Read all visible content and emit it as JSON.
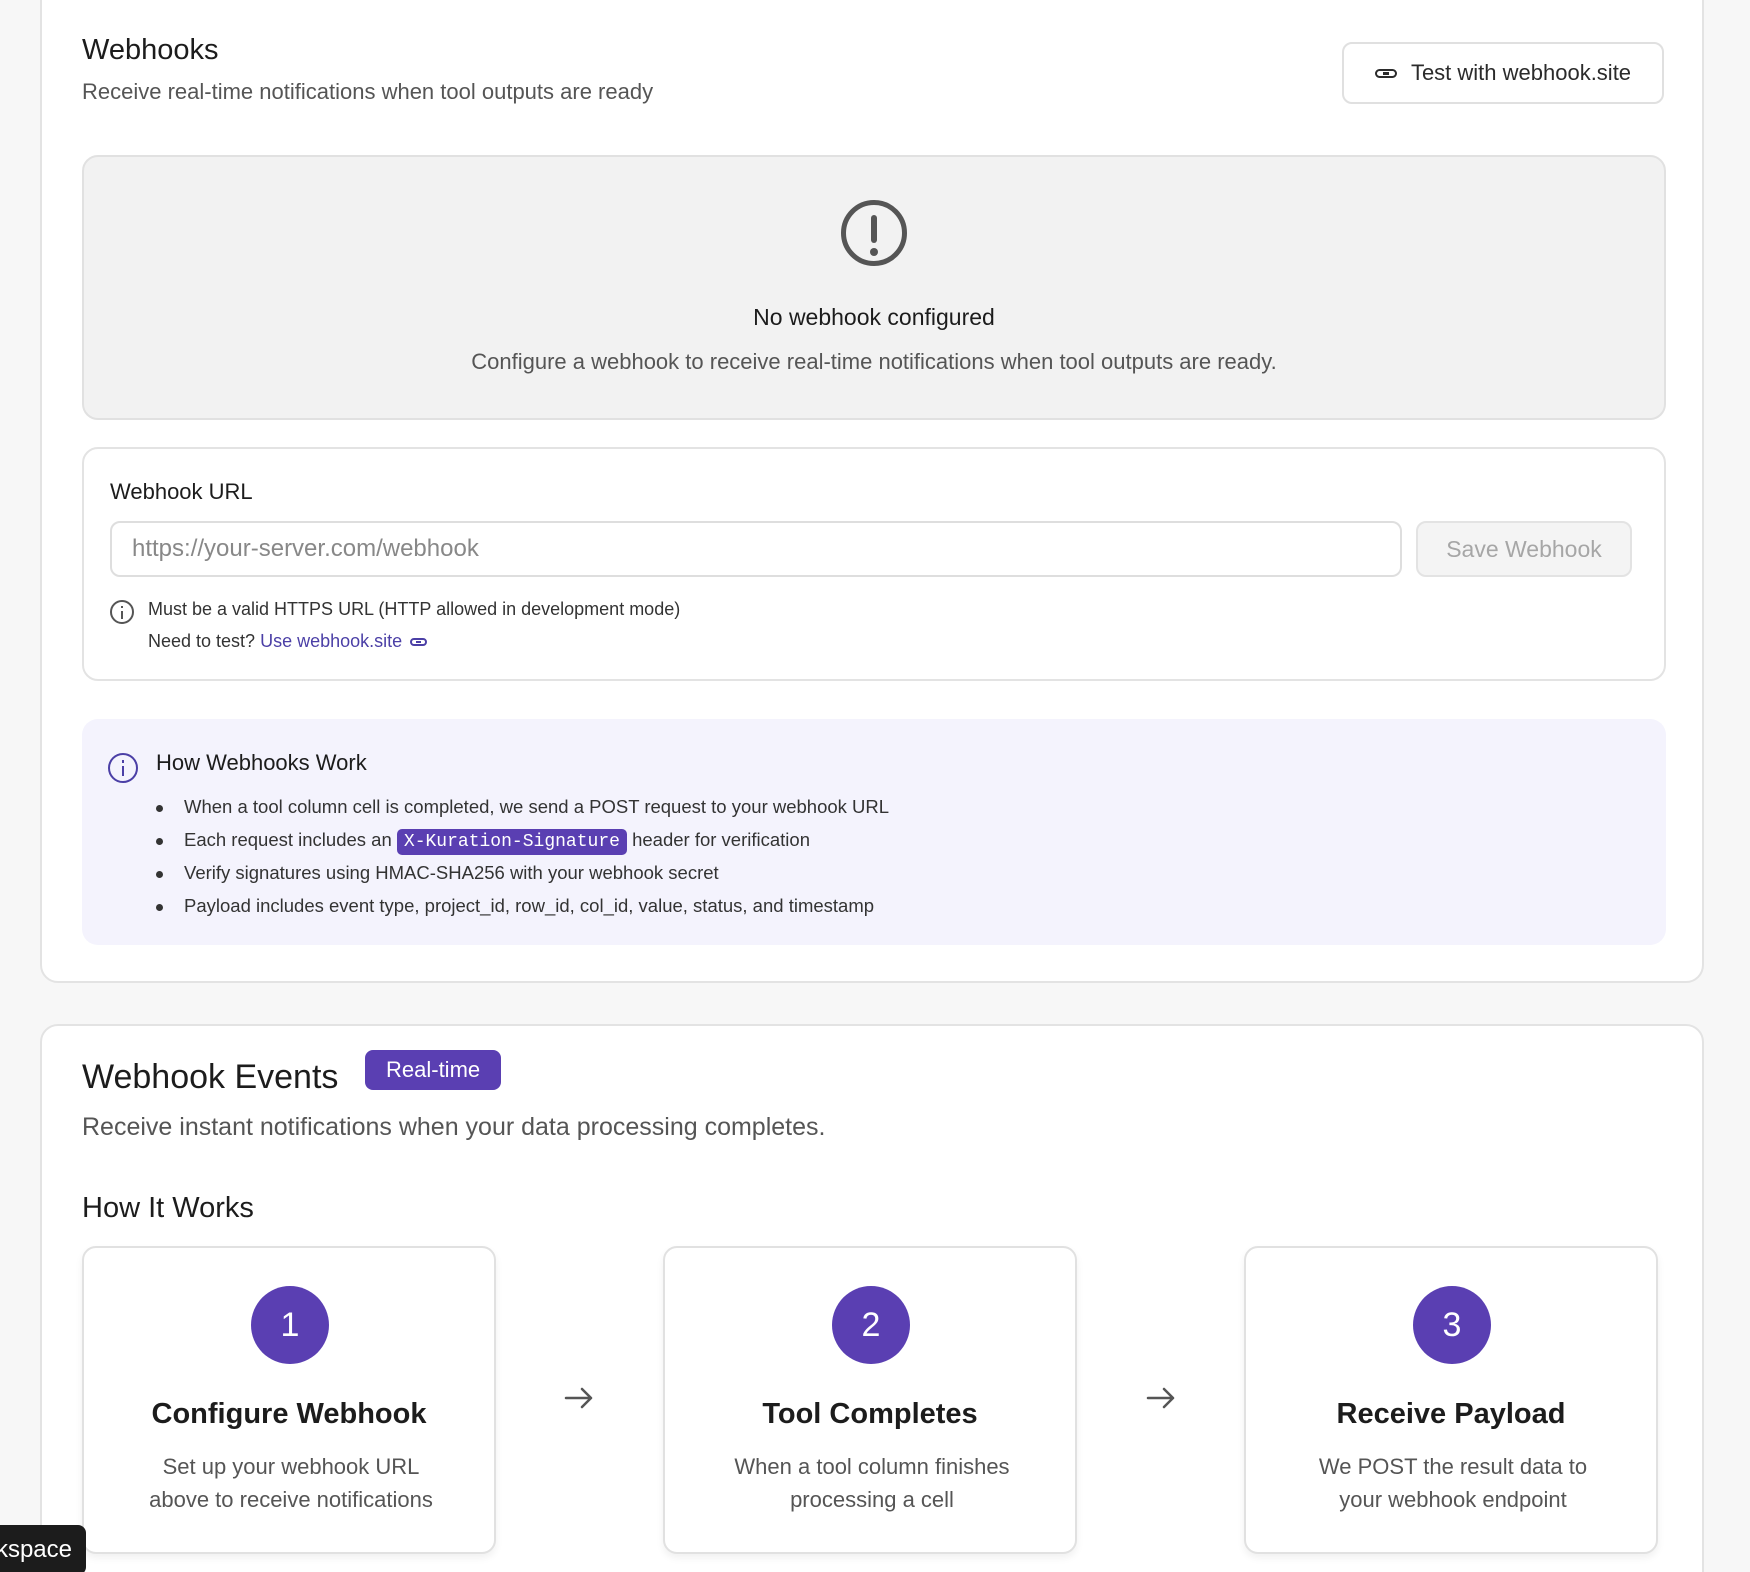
{
  "webhooks": {
    "title": "Webhooks",
    "subtitle": "Receive real-time notifications when tool outputs are ready",
    "test_button": "Test with webhook.site",
    "empty_state": {
      "icon": "alert-circle-icon",
      "title": "No webhook configured",
      "description": "Configure a webhook to receive real-time notifications when tool outputs are ready."
    },
    "url_form": {
      "label": "Webhook URL",
      "placeholder": "https://your-server.com/webhook",
      "value": "",
      "save_button": "Save Webhook",
      "help_text": "Must be a valid HTTPS URL (HTTP allowed in development mode)",
      "test_prefix": "Need to test?",
      "test_link": "Use webhook.site"
    },
    "how_it_works": {
      "title": "How Webhooks Work",
      "items": [
        "When a tool column cell is completed, we send a POST request to your webhook URL",
        "Verify signatures using HMAC-SHA256 with your webhook secret",
        "Payload includes event type, project_id, row_id, col_id, value, status, and timestamp"
      ],
      "signature_item": {
        "before": "Each request includes an",
        "code": "X-Kuration-Signature",
        "after": "header for verification"
      }
    }
  },
  "events": {
    "title": "Webhook Events",
    "badge": "Real-time",
    "subtitle": "Receive instant notifications when your data processing completes.",
    "how_title": "How It Works",
    "steps": [
      {
        "number": "1",
        "title": "Configure Webhook",
        "desc_line1": "Set up your webhook URL",
        "desc_line2": "above to receive notifications"
      },
      {
        "number": "2",
        "title": "Tool Completes",
        "desc_line1": "When a tool column finishes",
        "desc_line2": "processing a cell"
      },
      {
        "number": "3",
        "title": "Receive Payload",
        "desc_line1": "We POST the result data to",
        "desc_line2": "your webhook endpoint"
      }
    ]
  },
  "tooltip": "kspace",
  "colors": {
    "accent": "#5a3fb2",
    "link": "#4b3fa6",
    "info_bg": "#f4f3fd"
  }
}
